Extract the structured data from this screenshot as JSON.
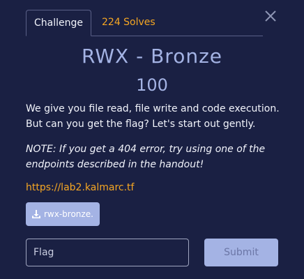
{
  "tabs": [
    {
      "label": "Challenge",
      "active": true
    },
    {
      "label": "224 Solves",
      "active": false
    }
  ],
  "challenge": {
    "title": "RWX - Bronze",
    "points": "100",
    "description": "We give you file read, file write and code execution. But can you get the flag? Let's start out gently.",
    "note": "NOTE: If you get a 404 error, try using one of the endpoints described in the handout!",
    "link": "https://lab2.kalmarc.tf",
    "attachment": "rwx-bronze..."
  },
  "form": {
    "flag_placeholder": "Flag",
    "submit_label": "Submit"
  },
  "icons": {
    "close": "close-icon",
    "download": "download-icon"
  },
  "colors": {
    "background": "#1a2043",
    "accent": "#f5a623",
    "title": "#a4b3e4",
    "button": "#a4b3e4"
  }
}
